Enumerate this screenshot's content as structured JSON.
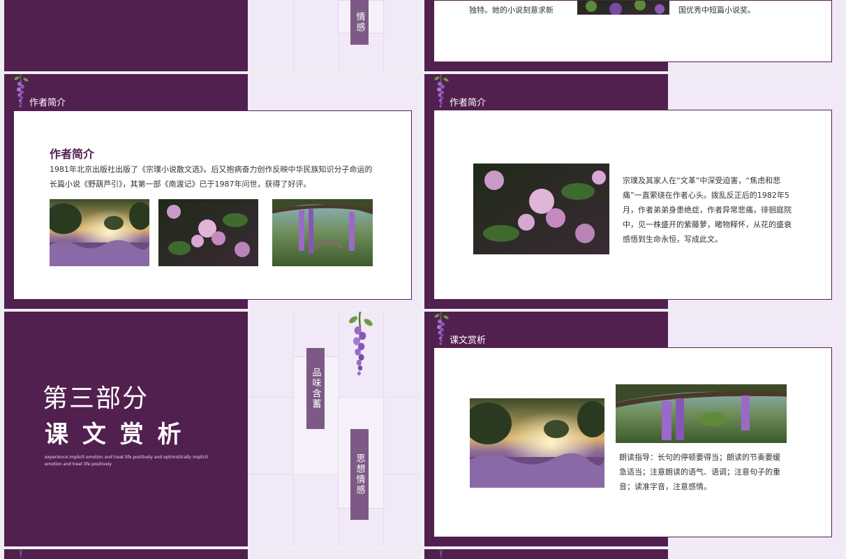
{
  "slide_partial_top_left": {
    "tag": "情感"
  },
  "slide_partial_top_right": {
    "text_left": "独特。她的小说刻意求新",
    "text_right": "国优秀中短篇小说奖。"
  },
  "slide_author_1": {
    "header": "作者简介",
    "title": "作者简介",
    "paragraph": "1981年北京出版社出版了《宗璞小说散文选》。后又抱病奋力创作反映中华民族知识分子命运的长篇小说《野葫芦引》，其第一部《南渡记》已于1987年问世，获得了好评。"
  },
  "slide_author_2": {
    "header": "作者简介",
    "paragraph": "宗璞及其家人在“文革”中深受迫害，“焦虑和悲痛”一直萦绕在作者心头。拨乱反正后的1982年5月，作者弟弟身患绝症，作者异常悲痛，徘徊庭院中，见一株盛开的紫藤萝，睹物释怀，从花的盛衰感悟到生命永恒，写成此文。"
  },
  "slide_section_3": {
    "part_label": "第三部分",
    "section_title": "课 文 赏 析",
    "subtitle_en": "experience implicit emotion and treat life positively and optimistically implicit emotion and treat life positively",
    "tag_1": "品味含蓄",
    "tag_2": "思想情感"
  },
  "slide_text_analysis": {
    "header": "课文赏析",
    "paragraph": "朗读指导：长句的停顿要得当；朗读的节奏要缓急适当；注意朗读的语气、语调；注意句子的重音；读准字音，注意感情。"
  },
  "colors": {
    "brand_purple": "#51204f",
    "tag_purple": "#7d5a85",
    "lavender_bg": "#f1e9f7"
  }
}
